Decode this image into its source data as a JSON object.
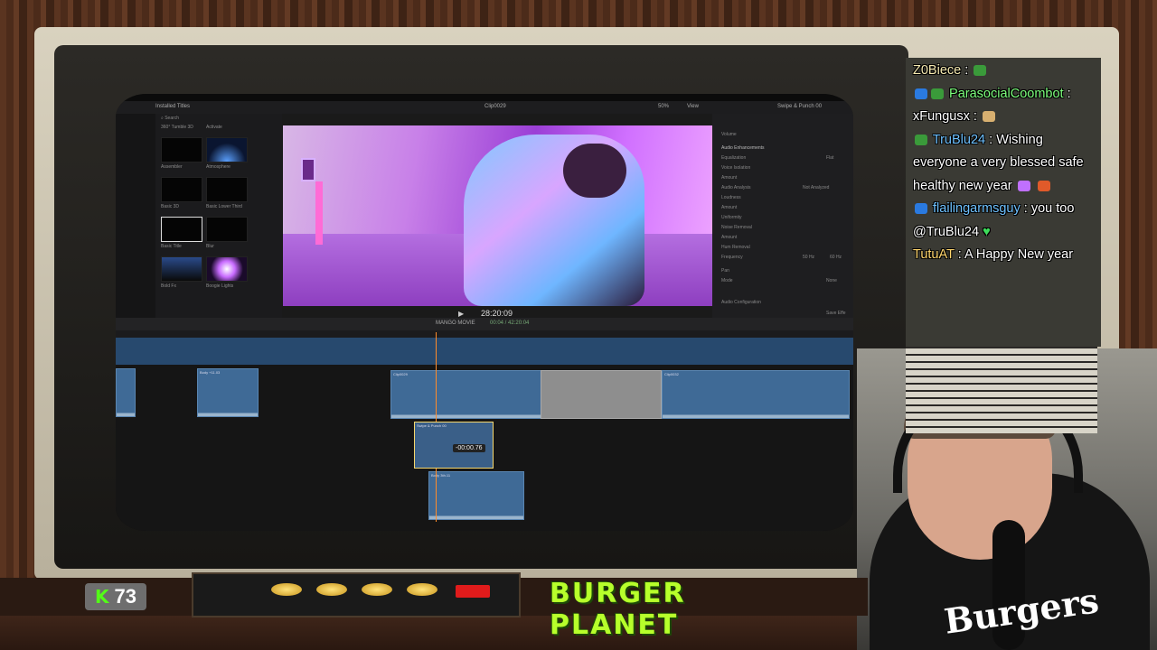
{
  "fcp": {
    "browser_title": "Installed Titles",
    "search_placeholder": "Search",
    "clip_name": "Clip0029",
    "zoom": "50%",
    "view_label": "View",
    "inspector_title": "Swipe & Punch 00",
    "inspector": {
      "volume": "Volume",
      "audio_enhancements": "Audio Enhancements",
      "equalization": "Equalization",
      "equalization_value": "Flat",
      "voice_isolation": "Voice Isolation",
      "amount": "Amount",
      "audio_analysis": "Audio Analysis",
      "audio_analysis_value": "Not Analyzed",
      "loudness": "Loudness",
      "uniformity": "Uniformity",
      "noise_removal": "Noise Removal",
      "hum_removal": "Hum Removal",
      "frequency": "Frequency",
      "frequency_value": "50 Hz",
      "frequency_value_2": "60 Hz",
      "pan": "Pan",
      "mode": "Mode",
      "mode_value": "None",
      "audio_configuration": "Audio Configuration",
      "save_effects": "Save Effe"
    },
    "titles": [
      {
        "label": "360° Tumble 3D"
      },
      {
        "label": "Activate"
      },
      {
        "label": "Assembler"
      },
      {
        "label": "Atmosphere"
      },
      {
        "label": "Basic 3D"
      },
      {
        "label": "Basic Lower Third"
      },
      {
        "label": "Basic Title"
      },
      {
        "label": "Blur"
      },
      {
        "label": "Bold Fx"
      },
      {
        "label": "Boogie Lights"
      }
    ],
    "timecode": "28:20:09",
    "project_name": "MANGO MOVIE",
    "duration": "00:04 / 42:20:04",
    "drag_offset": "-00:00.76",
    "clips": {
      "c1": "Body +11.03",
      "c2": "Clip0029",
      "c3": "Clip0032",
      "drag": "Swipe & Punch 00",
      "lower": "Body 3th.11"
    }
  },
  "chat": {
    "messages": [
      {
        "user": "Z0Biece",
        "text": ""
      },
      {
        "user": "ParasocialCoombot",
        "text": ""
      },
      {
        "user": "xFungusx",
        "text": ""
      },
      {
        "user": "TruBlu24",
        "text": "Wishing everyone a very blessed safe healthy new year"
      },
      {
        "user": "flailingarmsguy",
        "text": "you too @TruBlu24"
      },
      {
        "user": "TutuAT",
        "text": "A Happy New year"
      }
    ]
  },
  "overlay": {
    "kick_count": "73",
    "banner": "BURGER PLANET",
    "shirt_text": "Burgers"
  },
  "colors": {
    "kick_green": "#53fc18",
    "banner_green": "#b7ff2b",
    "playhead": "#ff8c2a",
    "clip_blue": "#3f6a96"
  }
}
